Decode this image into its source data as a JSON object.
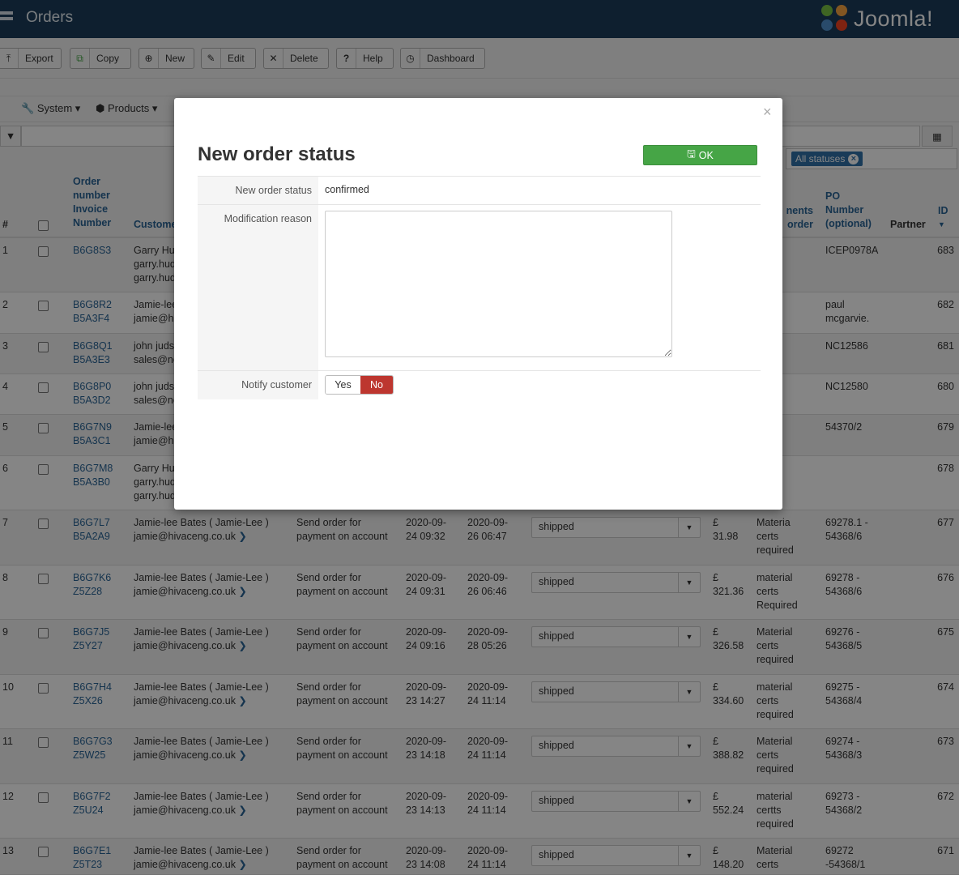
{
  "header": {
    "title": "Orders",
    "brand": "Joomla!"
  },
  "toolbar": [
    {
      "icon": "upload-icon",
      "glyph": "⤒",
      "label": "Export"
    },
    {
      "icon": "copy-icon",
      "glyph": "⧉",
      "label": "Copy"
    },
    {
      "icon": "plus-icon",
      "glyph": "⊕",
      "label": "New"
    },
    {
      "icon": "edit-icon",
      "glyph": "✎",
      "label": "Edit"
    },
    {
      "icon": "delete-icon",
      "glyph": "✕",
      "label": "Delete"
    },
    {
      "icon": "help-icon",
      "glyph": "?",
      "label": "Help"
    },
    {
      "icon": "dashboard-icon",
      "glyph": "◷",
      "label": "Dashboard"
    }
  ],
  "nav": {
    "system": "System",
    "products": "Products"
  },
  "filters": {
    "status_pill": "All statuses"
  },
  "table": {
    "headers": {
      "num": "#",
      "order": [
        "Order",
        "number",
        "Invoice",
        "Number"
      ],
      "customer": "Custome",
      "comments": [
        "nents",
        "order"
      ],
      "po": [
        "PO",
        "Number",
        "(optional)"
      ],
      "partner": "Partner",
      "id": "ID"
    },
    "rows": [
      {
        "n": "1",
        "order": "B6G8S3",
        "inv": "",
        "customer": [
          "Garry Hu",
          "garry.hud",
          "garry.hud"
        ],
        "po": [
          "ICEP0978A"
        ],
        "id": "683"
      },
      {
        "n": "2",
        "order": "B6G8R2",
        "inv": "B5A3F4",
        "customer": [
          "Jamie-lee",
          "jamie@hi"
        ],
        "po": [
          "paul",
          "mcgarvie."
        ],
        "id": "682"
      },
      {
        "n": "3",
        "order": "B6G8Q1",
        "inv": "B5A3E3",
        "customer": [
          "john juds",
          "sales@nc"
        ],
        "po": [
          "NC12586"
        ],
        "id": "681"
      },
      {
        "n": "4",
        "order": "B6G8P0",
        "inv": "B5A3D2",
        "customer": [
          "john juds",
          "sales@nc"
        ],
        "po": [
          "NC12580"
        ],
        "id": "680"
      },
      {
        "n": "5",
        "order": "B6G7N9",
        "inv": "B5A3C1",
        "customer": [
          "Jamie-lee",
          "jamie@hi"
        ],
        "po": [
          "54370/2"
        ],
        "id": "679"
      },
      {
        "n": "6",
        "order": "B6G7M8",
        "inv": "B5A3B0",
        "customer": [
          "Garry Hu",
          "garry.hud",
          "garry.hud"
        ],
        "po": [],
        "id": "678"
      },
      {
        "n": "7",
        "order": "B6G7L7",
        "inv": "B5A2A9",
        "customer": [
          "Jamie-lee Bates ( Jamie-Lee )",
          "jamie@hivaceng.co.uk"
        ],
        "method": [
          "Send order for",
          "payment on account"
        ],
        "created": [
          "2020-09-",
          "24 09:32"
        ],
        "modified": [
          "2020-09-",
          "26 06:47"
        ],
        "status": "shipped",
        "total": [
          "£",
          "31.98"
        ],
        "comments": [
          "Materia",
          "certs",
          "required"
        ],
        "po": [
          "69278.1 -",
          "54368/6"
        ],
        "id": "677"
      },
      {
        "n": "8",
        "order": "B6G7K6",
        "inv": "Z5Z28",
        "customer": [
          "Jamie-lee Bates ( Jamie-Lee )",
          "jamie@hivaceng.co.uk"
        ],
        "method": [
          "Send order for",
          "payment on account"
        ],
        "created": [
          "2020-09-",
          "24 09:31"
        ],
        "modified": [
          "2020-09-",
          "26 06:46"
        ],
        "status": "shipped",
        "total": [
          "£",
          "321.36"
        ],
        "comments": [
          "material",
          "certs",
          "Required"
        ],
        "po": [
          "69278 -",
          "54368/6"
        ],
        "id": "676"
      },
      {
        "n": "9",
        "order": "B6G7J5",
        "inv": "Z5Y27",
        "customer": [
          "Jamie-lee Bates ( Jamie-Lee )",
          "jamie@hivaceng.co.uk"
        ],
        "method": [
          "Send order for",
          "payment on account"
        ],
        "created": [
          "2020-09-",
          "24 09:16"
        ],
        "modified": [
          "2020-09-",
          "28 05:26"
        ],
        "status": "shipped",
        "total": [
          "£",
          "326.58"
        ],
        "comments": [
          "Material",
          "certs",
          "required"
        ],
        "po": [
          "69276 -",
          "54368/5"
        ],
        "id": "675"
      },
      {
        "n": "10",
        "order": "B6G7H4",
        "inv": "Z5X26",
        "customer": [
          "Jamie-lee Bates ( Jamie-Lee )",
          "jamie@hivaceng.co.uk"
        ],
        "method": [
          "Send order for",
          "payment on account"
        ],
        "created": [
          "2020-09-",
          "23 14:27"
        ],
        "modified": [
          "2020-09-",
          "24 11:14"
        ],
        "status": "shipped",
        "total": [
          "£",
          "334.60"
        ],
        "comments": [
          "material",
          "certs",
          "required"
        ],
        "po": [
          "69275 -",
          "54368/4"
        ],
        "id": "674"
      },
      {
        "n": "11",
        "order": "B6G7G3",
        "inv": "Z5W25",
        "customer": [
          "Jamie-lee Bates ( Jamie-Lee )",
          "jamie@hivaceng.co.uk"
        ],
        "method": [
          "Send order for",
          "payment on account"
        ],
        "created": [
          "2020-09-",
          "23 14:18"
        ],
        "modified": [
          "2020-09-",
          "24 11:14"
        ],
        "status": "shipped",
        "total": [
          "£",
          "388.82"
        ],
        "comments": [
          "Material",
          "certs",
          "required"
        ],
        "po": [
          "69274 -",
          "54368/3"
        ],
        "id": "673"
      },
      {
        "n": "12",
        "order": "B6G7F2",
        "inv": "Z5U24",
        "customer": [
          "Jamie-lee Bates ( Jamie-Lee )",
          "jamie@hivaceng.co.uk"
        ],
        "method": [
          "Send order for",
          "payment on account"
        ],
        "created": [
          "2020-09-",
          "23 14:13"
        ],
        "modified": [
          "2020-09-",
          "24 11:14"
        ],
        "status": "shipped",
        "total": [
          "£",
          "552.24"
        ],
        "comments": [
          "material",
          "certts",
          "required"
        ],
        "po": [
          "69273 -",
          "54368/2"
        ],
        "id": "672"
      },
      {
        "n": "13",
        "order": "B6G7E1",
        "inv": "Z5T23",
        "customer": [
          "Jamie-lee Bates ( Jamie-Lee )",
          "jamie@hivaceng.co.uk"
        ],
        "method": [
          "Send order for",
          "payment on account"
        ],
        "created": [
          "2020-09-",
          "23 14:08"
        ],
        "modified": [
          "2020-09-",
          "24 11:14"
        ],
        "status": "shipped",
        "total": [
          "£",
          "148.20"
        ],
        "comments": [
          "Material",
          "certs"
        ],
        "po": [
          "69272",
          "-54368/1"
        ],
        "id": "671"
      }
    ]
  },
  "modal": {
    "title": "New order status",
    "ok_label": "OK",
    "close_glyph": "×",
    "status_label": "New order status",
    "status_value": "confirmed",
    "reason_label": "Modification reason",
    "reason_value": "",
    "notify_label": "Notify customer",
    "notify_yes": "Yes",
    "notify_no": "No",
    "notify_selected": "No"
  },
  "colors": {
    "header_bg": "#1c3d5a",
    "link": "#2a6496",
    "ok_green": "#46a546",
    "no_red": "#bd362f",
    "pill_blue": "#3071a9"
  }
}
